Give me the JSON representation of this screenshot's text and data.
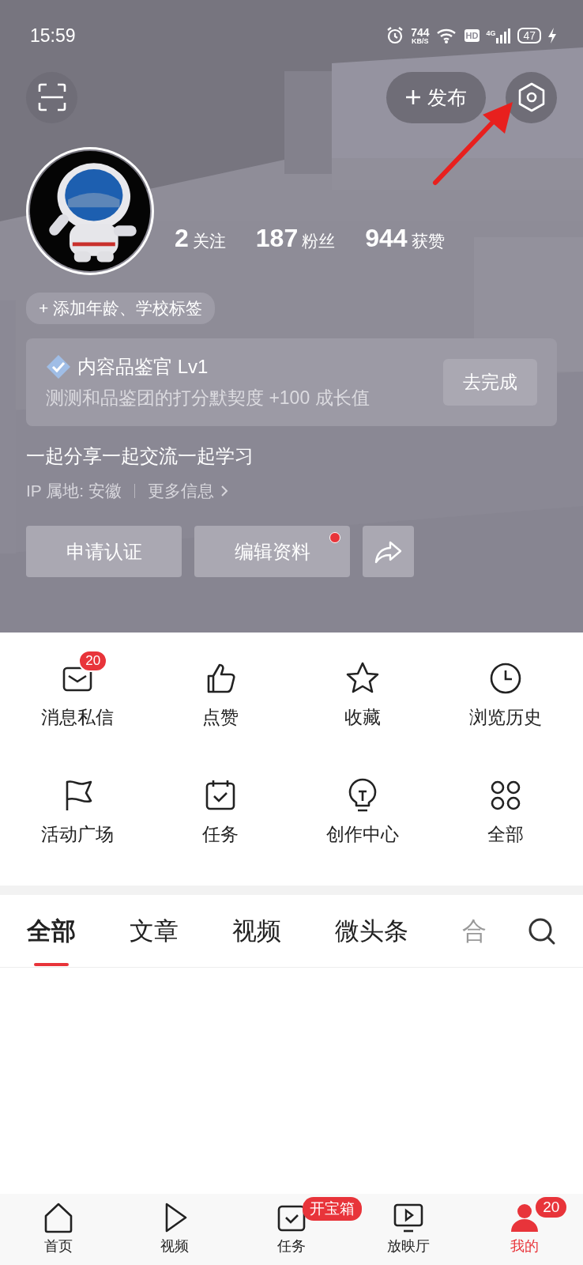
{
  "status_bar": {
    "time": "15:59",
    "net_speed": "744",
    "net_unit": "KB/S",
    "hd": "HD",
    "network": "4G",
    "battery": "47"
  },
  "header": {
    "publish_button": "发布"
  },
  "stats": [
    "**2**关注",
    "**187**粉丝",
    "**944**获赞"
  ],
  "tag_button": "+ 添加年龄、学校标签",
  "badge_card": {
    "title": "内容品鉴官 Lv1",
    "description": "测测和品鉴团的打分默契度 +100 成长值",
    "button": "去完成"
  },
  "bio": "一起分享一起交流一起学习",
  "ip_location": "IP 属地: 安徽",
  "more_info": "更多信息",
  "actions": [
    {
      "label": "申请认证",
      "dot": false
    },
    {
      "label": "编辑资料",
      "dot": true
    }
  ],
  "shortcuts": [
    {
      "label": "消息私信",
      "badge": "20"
    },
    {
      "label": "点赞"
    },
    {
      "label": "收藏"
    },
    {
      "label": "浏览历史"
    },
    {
      "label": "活动广场"
    },
    {
      "label": "任务"
    },
    {
      "label": "创作中心"
    },
    {
      "label": "全部"
    }
  ],
  "tabs": [
    {
      "label": "全部",
      "selected": true
    },
    {
      "label": "文章",
      "selected": false
    },
    {
      "label": "视频",
      "selected": false
    },
    {
      "label": "微头条",
      "selected": false
    },
    {
      "label": "合",
      "selected": false
    }
  ],
  "bottom_nav": [
    {
      "label": "首页",
      "selected": false
    },
    {
      "label": "视频",
      "selected": false
    },
    {
      "label": "任务",
      "selected": false,
      "badge": "开宝箱"
    },
    {
      "label": "放映厅",
      "selected": false
    },
    {
      "label": "我的",
      "selected": true,
      "badge": "20"
    }
  ]
}
